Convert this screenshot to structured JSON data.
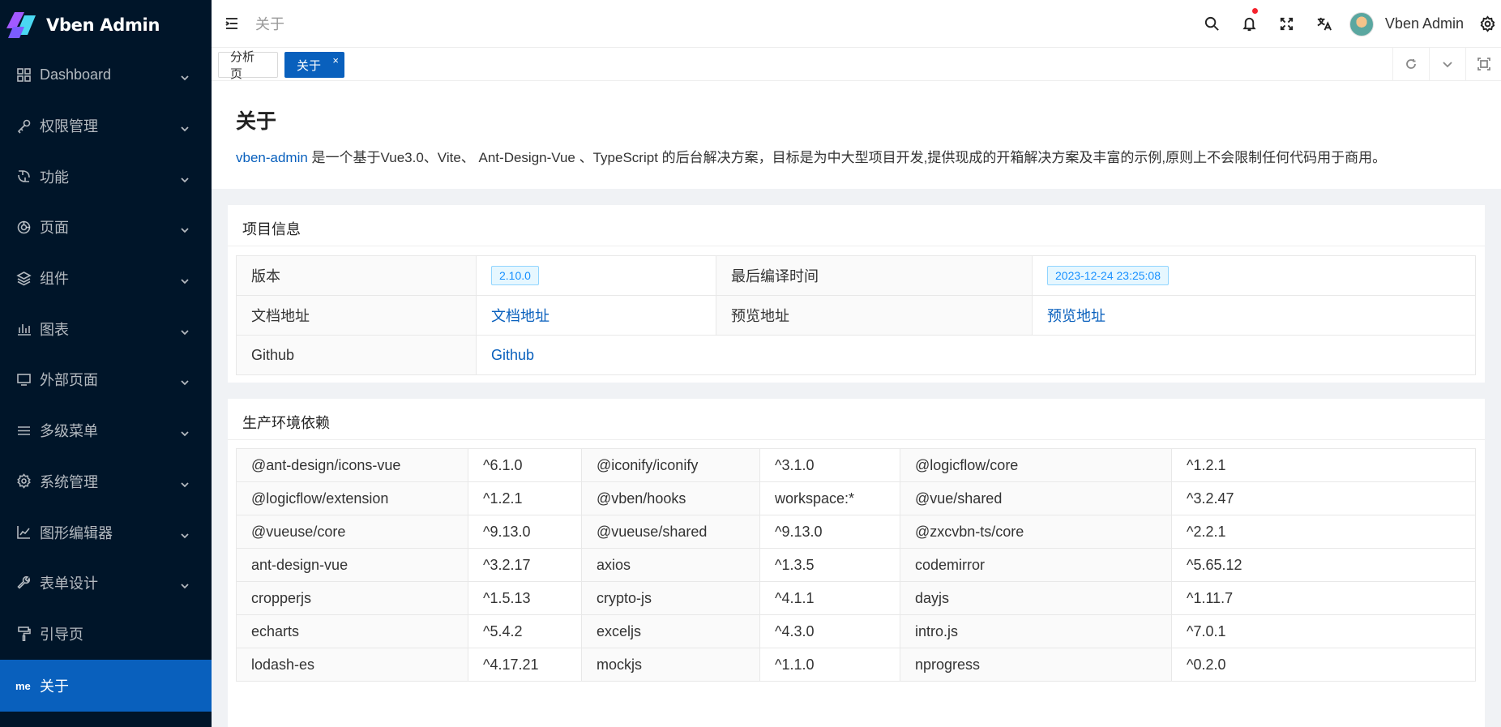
{
  "app": {
    "title": "Vben Admin"
  },
  "sidebar": {
    "items": [
      {
        "label": "Dashboard",
        "icon": "dashboard-grid-icon"
      },
      {
        "label": "权限管理",
        "icon": "key-icon"
      },
      {
        "label": "功能",
        "icon": "function-icon"
      },
      {
        "label": "页面",
        "icon": "page-icon"
      },
      {
        "label": "组件",
        "icon": "layers-icon"
      },
      {
        "label": "图表",
        "icon": "bar-chart-icon"
      },
      {
        "label": "外部页面",
        "icon": "monitor-icon"
      },
      {
        "label": "多级菜单",
        "icon": "menu-lines-icon"
      },
      {
        "label": "系统管理",
        "icon": "gear-icon"
      },
      {
        "label": "图形编辑器",
        "icon": "chart-editor-icon"
      },
      {
        "label": "表单设计",
        "icon": "wrench-icon"
      },
      {
        "label": "引导页",
        "icon": "paint-roller-icon"
      }
    ],
    "active": {
      "icon_text": "me",
      "label": "关于"
    }
  },
  "header": {
    "breadcrumb": "关于",
    "user_name": "Vben Admin"
  },
  "tabs": [
    {
      "label": "分析页"
    },
    {
      "label": "关于",
      "close": "×"
    }
  ],
  "about": {
    "title": "关于",
    "desc_link": "vben-admin",
    "desc_text": " 是一个基于Vue3.0、Vite、 Ant-Design-Vue 、TypeScript 的后台解决方案，目标是为中大型项目开发,提供现成的开箱解决方案及丰富的示例,原则上不会限制任何代码用于商用。"
  },
  "project_info": {
    "title": "项目信息",
    "version_label": "版本",
    "version": "2.10.0",
    "build_label": "最后编译时间",
    "build_time": "2023-12-24 23:25:08",
    "doc_label": "文档地址",
    "doc_link": "文档地址",
    "preview_label": "预览地址",
    "preview_link": "预览地址",
    "github_label": "Github",
    "github_link": "Github"
  },
  "deps": {
    "title": "生产环境依赖",
    "rows": [
      [
        [
          "@ant-design/icons-vue",
          "^6.1.0"
        ],
        [
          "@iconify/iconify",
          "^3.1.0"
        ],
        [
          "@logicflow/core",
          "^1.2.1"
        ]
      ],
      [
        [
          "@logicflow/extension",
          "^1.2.1"
        ],
        [
          "@vben/hooks",
          "workspace:*"
        ],
        [
          "@vue/shared",
          "^3.2.47"
        ]
      ],
      [
        [
          "@vueuse/core",
          "^9.13.0"
        ],
        [
          "@vueuse/shared",
          "^9.13.0"
        ],
        [
          "@zxcvbn-ts/core",
          "^2.2.1"
        ]
      ],
      [
        [
          "ant-design-vue",
          "^3.2.17"
        ],
        [
          "axios",
          "^1.3.5"
        ],
        [
          "codemirror",
          "^5.65.12"
        ]
      ],
      [
        [
          "cropperjs",
          "^1.5.13"
        ],
        [
          "crypto-js",
          "^4.1.1"
        ],
        [
          "dayjs",
          "^1.11.7"
        ]
      ],
      [
        [
          "echarts",
          "^5.4.2"
        ],
        [
          "exceljs",
          "^4.3.0"
        ],
        [
          "intro.js",
          "^7.0.1"
        ]
      ],
      [
        [
          "lodash-es",
          "^4.17.21"
        ],
        [
          "mockjs",
          "^1.1.0"
        ],
        [
          "nprogress",
          "^0.2.0"
        ]
      ]
    ]
  }
}
